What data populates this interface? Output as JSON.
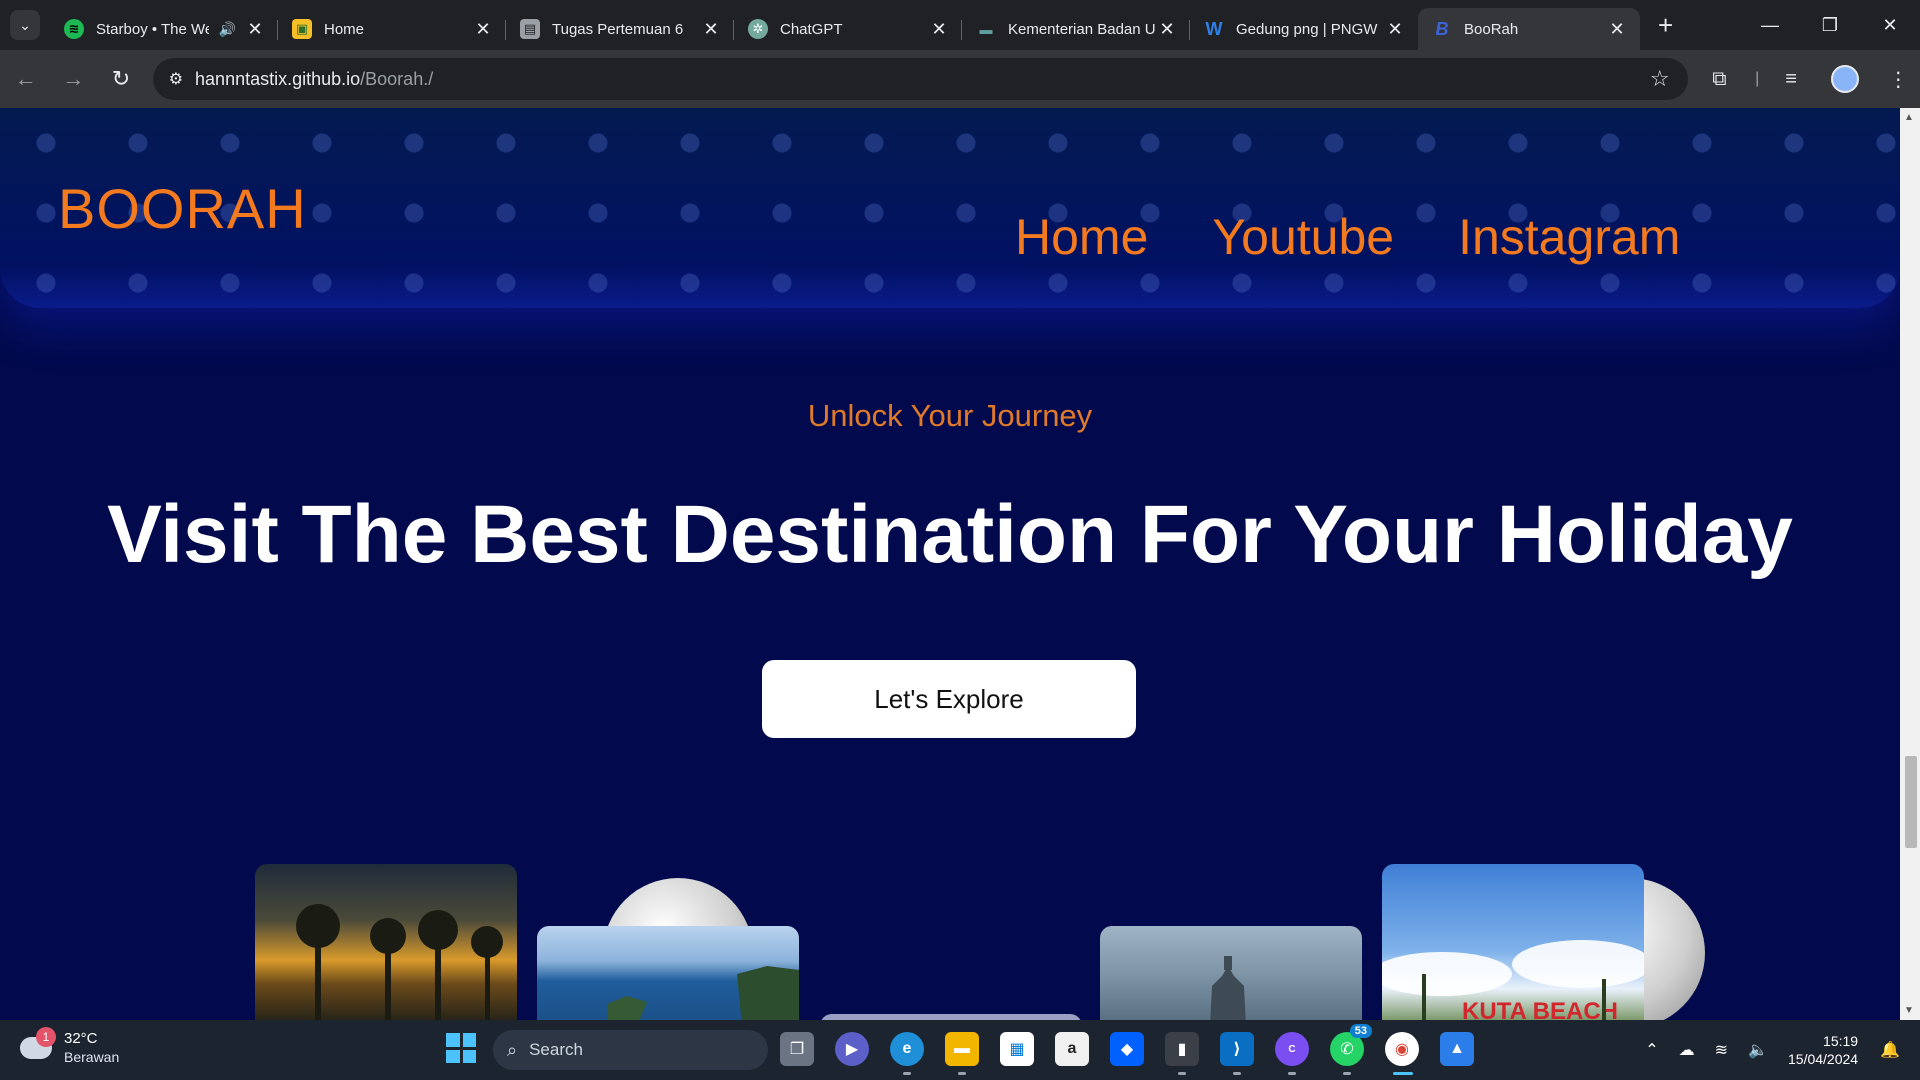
{
  "browser": {
    "tabs": [
      {
        "title": "Starboy • The We",
        "icon": "spotify-icon",
        "color": "#1db954",
        "audio": true
      },
      {
        "title": "Home",
        "icon": "classroom-icon",
        "color": "#f6bf26"
      },
      {
        "title": "Tugas Pertemuan 6",
        "icon": "assignment-icon",
        "color": "#9aa0a6"
      },
      {
        "title": "ChatGPT",
        "icon": "chatgpt-icon",
        "color": "#74aa9c"
      },
      {
        "title": "Kementerian Badan U",
        "icon": "site-icon",
        "color": "#5f6368"
      },
      {
        "title": "Gedung png | PNGW",
        "icon": "pngwing-icon",
        "color": "#2f7fe8"
      },
      {
        "title": "BooRah",
        "icon": "boorah-icon",
        "color": "#3b63d8",
        "active": true
      }
    ],
    "url_host": "hannntastix.github.io",
    "url_path": "/Boorah./"
  },
  "page": {
    "brand": "BOORAH",
    "nav": [
      "Home",
      "Youtube",
      "Instagram"
    ],
    "kicker": "Unlock Your Journey",
    "title": "Visit The Best Destination For Your Holiday",
    "cta": "Let's Explore"
  },
  "taskbar": {
    "weather_temp": "32°C",
    "weather_cond": "Berawan",
    "weather_badge": "1",
    "search_label": "Search",
    "whatsapp_badge": "53",
    "time": "15:19",
    "date": "15/04/2024"
  },
  "colors": {
    "accent": "#f47a1f",
    "page_bg": "#020a4d"
  }
}
